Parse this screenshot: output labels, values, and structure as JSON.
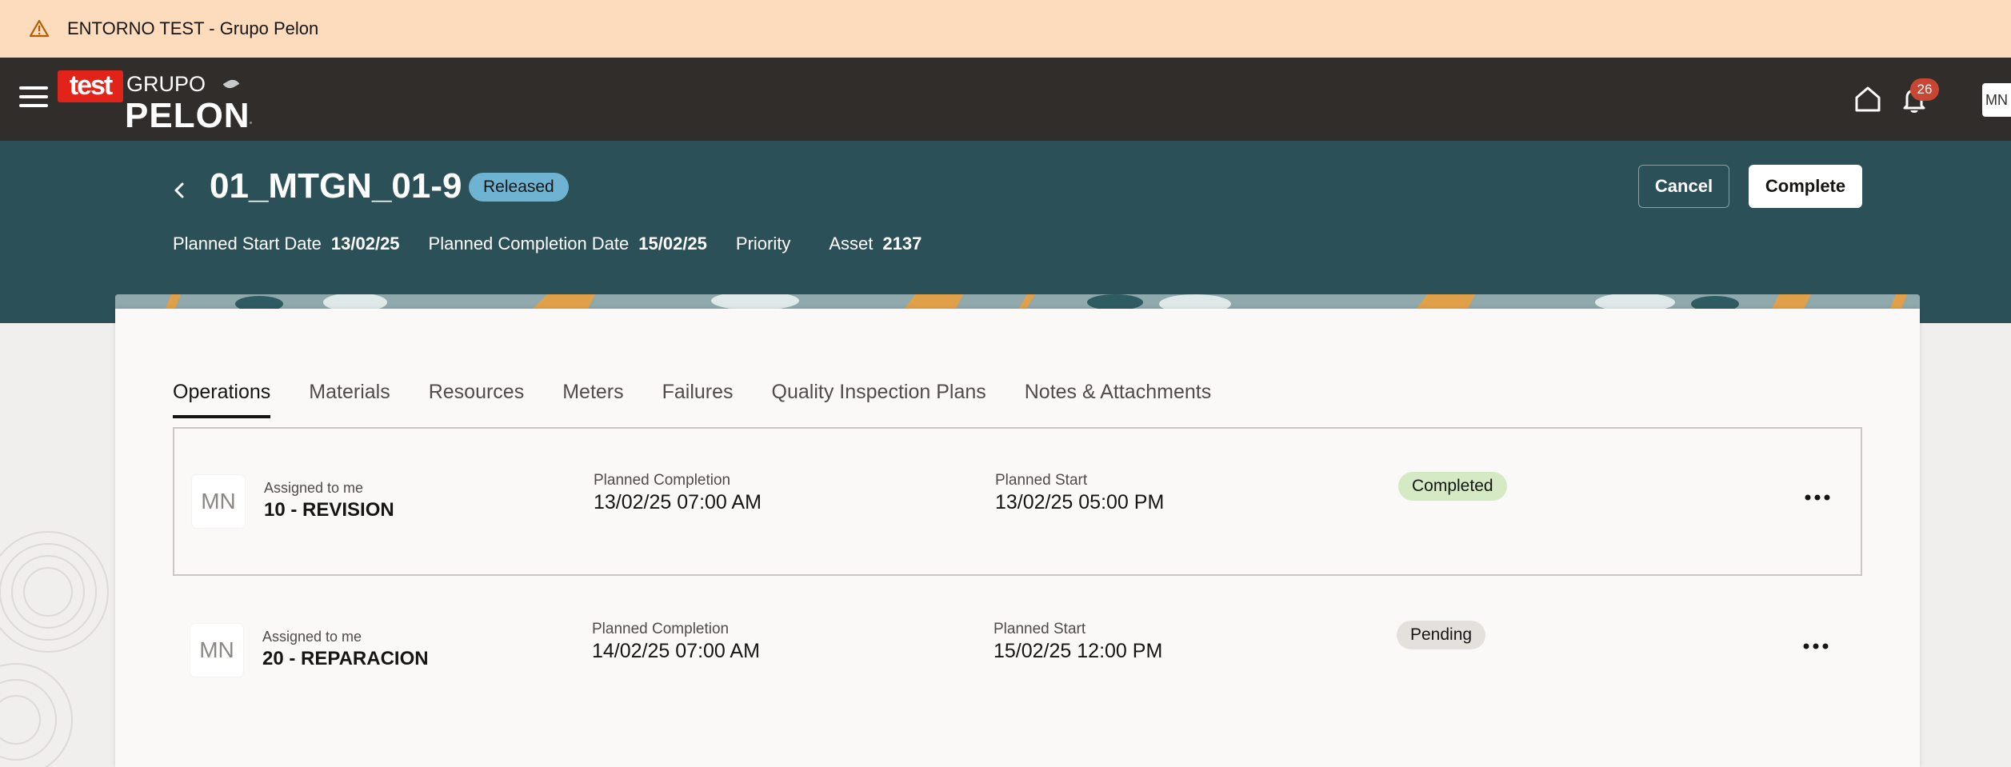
{
  "env_banner": {
    "text": "ENTORNO TEST - Grupo Pelon",
    "icon": "warning-icon"
  },
  "header": {
    "logo": {
      "badge": "test",
      "line1": "GRUPO",
      "line2": "PELON"
    },
    "notifications_count": "26",
    "user_initials": "MN"
  },
  "work_order": {
    "title": "01_MTGN_01-9",
    "status": "Released",
    "cancel_label": "Cancel",
    "complete_label": "Complete",
    "meta": {
      "planned_start_label": "Planned Start Date",
      "planned_start_value": "13/02/25",
      "planned_completion_label": "Planned Completion Date",
      "planned_completion_value": "15/02/25",
      "priority_label": "Priority",
      "asset_label": "Asset",
      "asset_value": "2137"
    }
  },
  "tabs": [
    "Operations",
    "Materials",
    "Resources",
    "Meters",
    "Failures",
    "Quality Inspection Plans",
    "Notes & Attachments"
  ],
  "operations": [
    {
      "avatar": "MN",
      "assigned": "Assigned to me",
      "name": "10 - REVISION",
      "planned_completion_label": "Planned Completion",
      "planned_completion": "13/02/25 07:00 AM",
      "planned_start_label": "Planned Start",
      "planned_start": "13/02/25 05:00 PM",
      "status": "Completed"
    },
    {
      "avatar": "MN",
      "assigned": "Assigned to me",
      "name": "20 - REPARACION",
      "planned_completion_label": "Planned Completion",
      "planned_completion": "14/02/25 07:00 AM",
      "planned_start_label": "Planned Start",
      "planned_start": "15/02/25 12:00 PM",
      "status": "Pending"
    }
  ],
  "colors": {
    "env_banner": "#fcdcbd",
    "topbar": "#312d2a",
    "page_header": "#2c5058",
    "released": "#6fb3d2",
    "completed": "#d4e9c4",
    "pending": "#e4e1dd",
    "notification_badge": "#c74634"
  }
}
